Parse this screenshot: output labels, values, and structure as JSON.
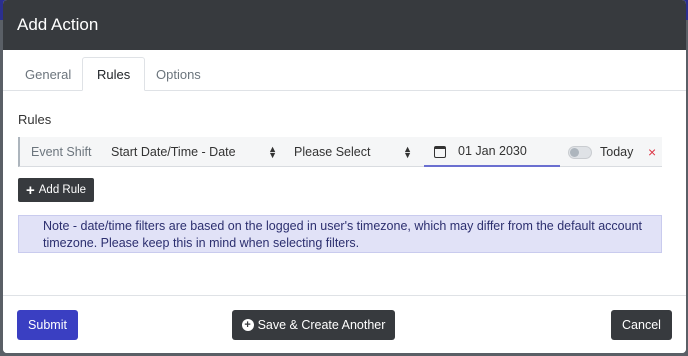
{
  "modal": {
    "title": "Add Action"
  },
  "tabs": [
    {
      "label": "General",
      "active": false
    },
    {
      "label": "Rules",
      "active": true
    },
    {
      "label": "Options",
      "active": false
    }
  ],
  "rules_section": {
    "label": "Rules",
    "rule": {
      "type": "Event Shift",
      "field_select": "Start Date/Time - Date",
      "operator_select": "Please Select",
      "date_value": "01 Jan 2030",
      "today_toggle": false,
      "today_label": "Today",
      "remove_symbol": "×"
    },
    "add_rule_label": "Add Rule"
  },
  "note": {
    "text": "Note - date/time filters are based on the logged in user's timezone, which may differ from the default account timezone. Please keep this in mind when selecting filters."
  },
  "footer": {
    "submit_label": "Submit",
    "save_create_label": "Save & Create Another",
    "cancel_label": "Cancel"
  },
  "colors": {
    "header_bg": "#373a3e",
    "primary": "#3a3fc2",
    "note_bg": "#e1e2f7",
    "danger": "#dc3545"
  },
  "icons": {
    "calendar": "calendar-icon",
    "remove": "close-icon",
    "add": "plus-icon",
    "save_create": "plus-circle-icon",
    "sort": "sort-arrows-icon"
  }
}
